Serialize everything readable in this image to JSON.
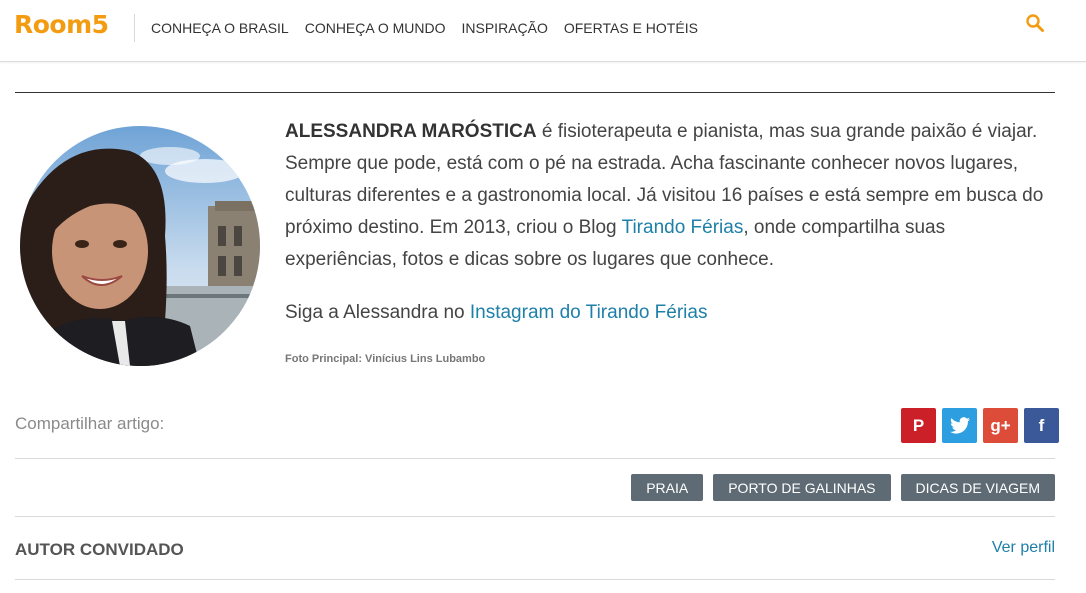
{
  "header": {
    "logo": "Room5",
    "nav": [
      "CONHEÇA O BRASIL",
      "CONHEÇA O MUNDO",
      "INSPIRAÇÃO",
      "OFERTAS E HOTÉIS"
    ],
    "search_icon": "search-icon",
    "accent_color": "#f39c12"
  },
  "author": {
    "name": "ALESSANDRA MARÓSTICA",
    "bio_part1": " é fisioterapeuta e pianista, mas sua grande paixão é viajar. Sempre que pode, está com o pé na estrada. Acha fascinante conhecer novos lugares, culturas diferentes e a gastronomia local. Já visitou 16 países e está sempre em busca do próximo destino. Em 2013, criou o Blog ",
    "blog_link": "Tirando Férias",
    "bio_part2": ", onde compartilha suas experiências, fotos e dicas sobre os lugares que conhece.",
    "follow_prefix": "Siga a Alessandra no ",
    "follow_link": "Instagram do Tirando Férias",
    "photo_credit": "Foto Principal: Vinícius Lins Lubambo",
    "link_color": "#1e7fa8"
  },
  "share": {
    "label": "Compartilhar artigo:",
    "buttons": [
      {
        "icon": "pinterest-icon",
        "glyph": "P"
      },
      {
        "icon": "twitter-icon",
        "glyph": "t"
      },
      {
        "icon": "google-plus-icon",
        "glyph": "g+"
      },
      {
        "icon": "facebook-icon",
        "glyph": "f"
      }
    ]
  },
  "tags": [
    "PRAIA",
    "PORTO DE GALINHAS",
    "DICAS DE VIAGEM"
  ],
  "footer": {
    "author_label": "AUTOR CONVIDADO",
    "profile_link": "Ver perfil"
  }
}
